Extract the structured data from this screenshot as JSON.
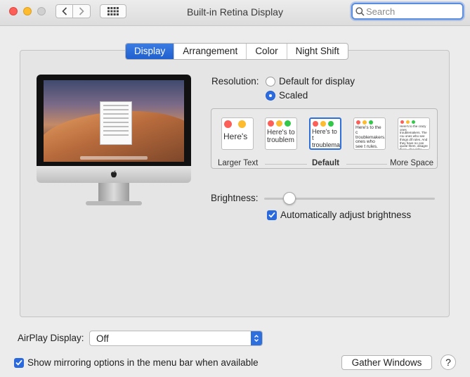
{
  "window": {
    "title": "Built-in Retina Display",
    "search_placeholder": "Search"
  },
  "toolbar": {
    "back_icon": "chevron-left-icon",
    "forward_icon": "chevron-right-icon",
    "show_all_icon": "grid-icon"
  },
  "tabs": [
    {
      "label": "Display",
      "active": true
    },
    {
      "label": "Arrangement",
      "active": false
    },
    {
      "label": "Color",
      "active": false
    },
    {
      "label": "Night Shift",
      "active": false
    }
  ],
  "resolution": {
    "label": "Resolution:",
    "options": [
      {
        "label": "Default for display",
        "selected": false
      },
      {
        "label": "Scaled",
        "selected": true
      }
    ]
  },
  "scaling": {
    "thumbnails": [
      {
        "text": "Here's"
      },
      {
        "text": "Here's to troublem"
      },
      {
        "text": "Here's to t troublema ones who"
      },
      {
        "text": "Here's to the c troublemakers. ones who see t rules. And they"
      },
      {
        "text": "Here's to the crazy ones troublemakers. The rou ones who see things dif rules. And they have no can quote them, disagre them. About the only thi Because they change th"
      }
    ],
    "selected_index": 2,
    "captions": {
      "left": "Larger Text",
      "center": "Default",
      "right": "More Space"
    }
  },
  "brightness": {
    "label": "Brightness:",
    "level": 0.12,
    "auto_label": "Automatically adjust brightness",
    "auto_checked": true
  },
  "airplay": {
    "label": "AirPlay Display:",
    "value": "Off"
  },
  "mirroring": {
    "label": "Show mirroring options in the menu bar when available",
    "checked": true
  },
  "buttons": {
    "gather": "Gather Windows",
    "help": "?"
  },
  "colors": {
    "accent": "#2c6be0",
    "close": "#fc5f57",
    "minimize": "#fdbb2e"
  }
}
